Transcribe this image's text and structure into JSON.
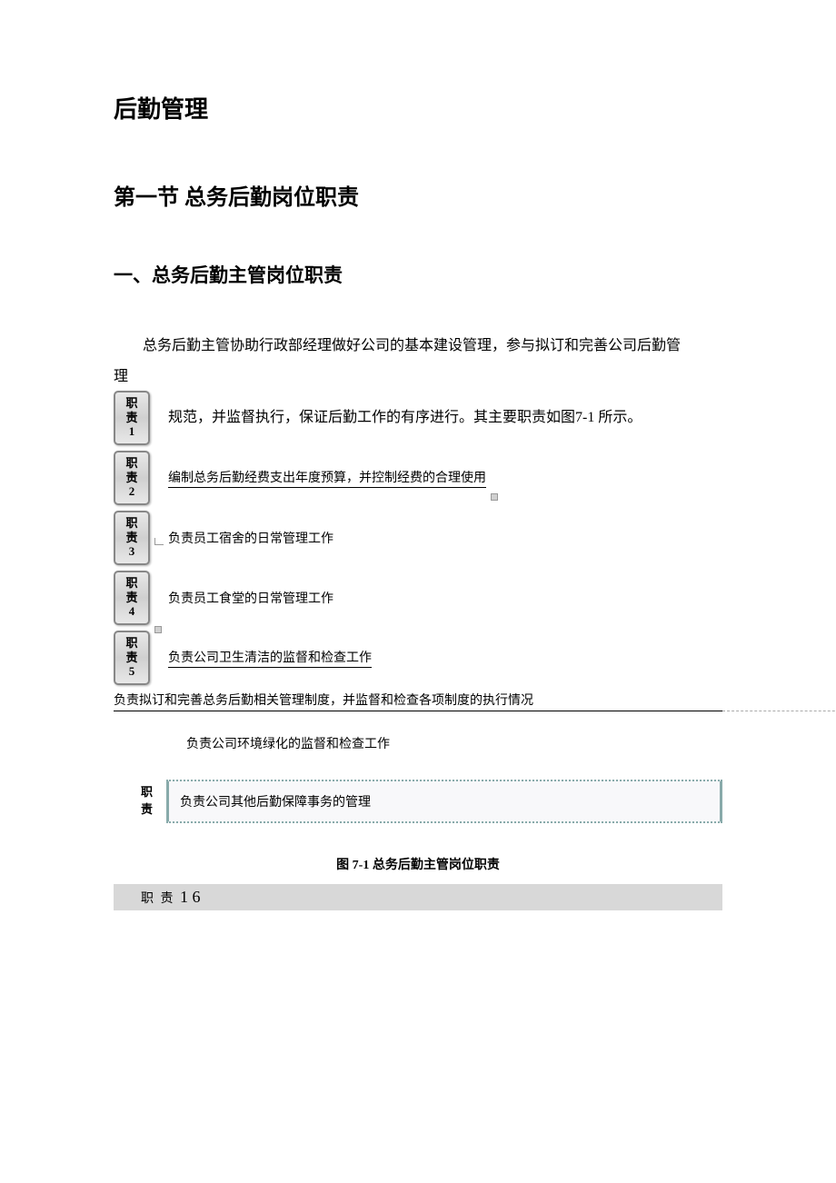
{
  "title": "后勤管理",
  "section_title": "第一节  总务后勤岗位职责",
  "subsection_title": "一、总务后勤主管岗位职责",
  "intro_line1": "总务后勤主管协助行政部经理做好公司的基本建设管理，参与拟订和完善公司后勤管",
  "intro_line2": "理",
  "intro_line3": "规范，并监督执行，保证后勤工作的有序进行。其主要职责如图7-1 所示。",
  "badges": {
    "prefix1": "职",
    "prefix2": "责",
    "b1": "1",
    "b2": "2",
    "b3": "3",
    "b4": "4",
    "b5": "5"
  },
  "duties": {
    "d2": "编制总务后勤经费支出年度预算，并控制经费的合理使用",
    "d3": "负责员工宿舍的日常管理工作",
    "d4": "负责员工食堂的日常管理工作",
    "d5": "负责公司卫生清洁的监督和检查工作",
    "d6": "负责拟订和完善总务后勤相关管理制度，并监督和检查各项制度的执行情况",
    "d7": "负责公司环境绿化的监督和检查工作",
    "d8": "负责公司其他后勤保障事务的管理"
  },
  "wide_badge": {
    "l1": "职",
    "l2": "责"
  },
  "figure_caption": "图 7-1 总务后勤主管岗位职责",
  "footer": {
    "prefix": "职 责 ",
    "nums": "1  6"
  }
}
